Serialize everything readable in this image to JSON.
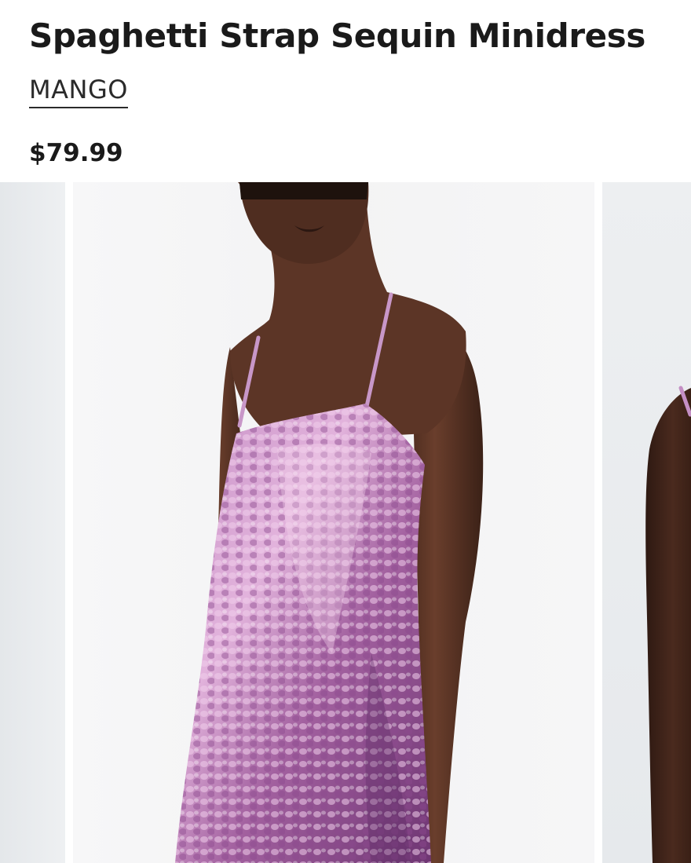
{
  "product": {
    "title": "Spaghetti Strap Sequin Minidress",
    "brand": "MANGO",
    "price": "$79.99"
  },
  "gallery": {
    "images": [
      {
        "name": "previous-product-image",
        "subject": "partial model photo, grey backdrop"
      },
      {
        "name": "main-product-image",
        "subject": "model wearing pink sequin minidress with spaghetti straps"
      },
      {
        "name": "next-product-image",
        "subject": "partial model photo, arm and strap visible"
      }
    ]
  },
  "colors": {
    "text": "#1a1a1a",
    "backdrop": "#f4f4f5",
    "side_backdrop": "#eceef0",
    "skin": "#5b3526",
    "sequin_light": "#e6b8e0",
    "sequin_mid": "#b06fb0",
    "sequin_dark": "#7a3f80"
  }
}
